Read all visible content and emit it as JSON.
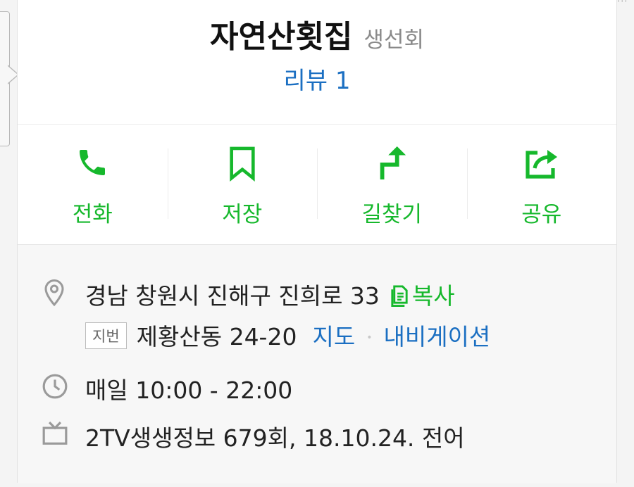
{
  "place": {
    "name": "자연산횟집",
    "category": "생선회",
    "review_label": "리뷰 1"
  },
  "actions": [
    {
      "label": "전화",
      "icon": "phone-icon"
    },
    {
      "label": "저장",
      "icon": "bookmark-icon"
    },
    {
      "label": "길찾기",
      "icon": "directions-icon"
    },
    {
      "label": "공유",
      "icon": "share-icon"
    }
  ],
  "info": {
    "address": "경남 창원시 진해구 진희로 33",
    "copy_label": "복사",
    "lot_badge": "지번",
    "lot_address": "제황산동 24-20",
    "map_link": "지도",
    "separator": "•",
    "navigation_link": "내비게이션",
    "hours": "매일 10:00 - 22:00",
    "tv": "2TV생생정보 679회, 18.10.24. 전어"
  },
  "colors": {
    "accent_green": "#16b82c",
    "link_blue": "#1b6fc2",
    "icon_gray": "#9a9a9a"
  }
}
